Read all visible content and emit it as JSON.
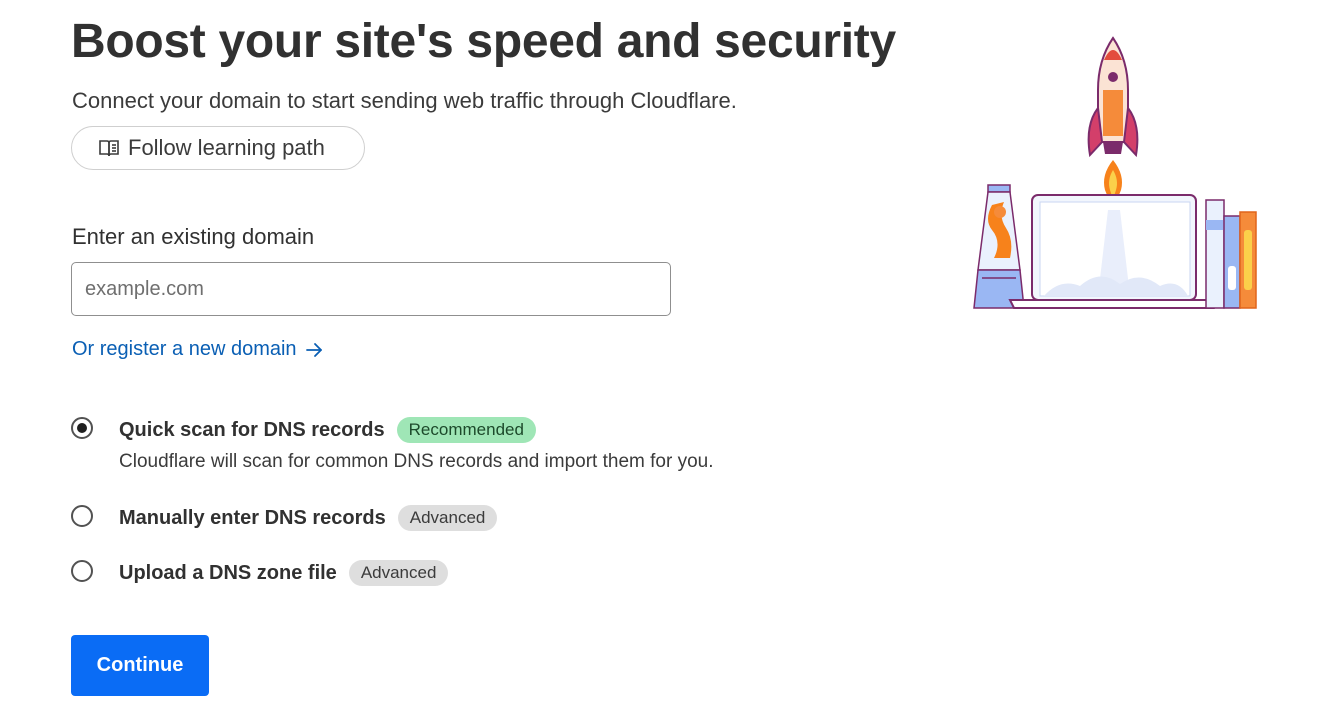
{
  "header": {
    "title": "Boost your site's speed and security",
    "subtitle": "Connect your domain to start sending web traffic through Cloudflare.",
    "learning_button_label": "Follow learning path",
    "learning_button_icon": "book-icon"
  },
  "domain": {
    "label": "Enter an existing domain",
    "placeholder": "example.com",
    "value": "",
    "register_link_label": "Or register a new domain",
    "register_link_icon": "arrow-right-icon"
  },
  "scan_options": [
    {
      "title": "Quick scan for DNS records",
      "badge": "Recommended",
      "description": "Cloudflare will scan for common DNS records and import them for you.",
      "selected": true
    },
    {
      "title": "Manually enter DNS records",
      "badge": "Advanced",
      "selected": false
    },
    {
      "title": "Upload a DNS zone file",
      "badge": "Advanced",
      "selected": false
    }
  ],
  "actions": {
    "continue_label": "Continue"
  },
  "colors": {
    "primary_button": "#0a6cf5",
    "link": "#0a5fb4",
    "recommended_badge": "#9fe6b6",
    "advanced_badge": "#dedede"
  }
}
